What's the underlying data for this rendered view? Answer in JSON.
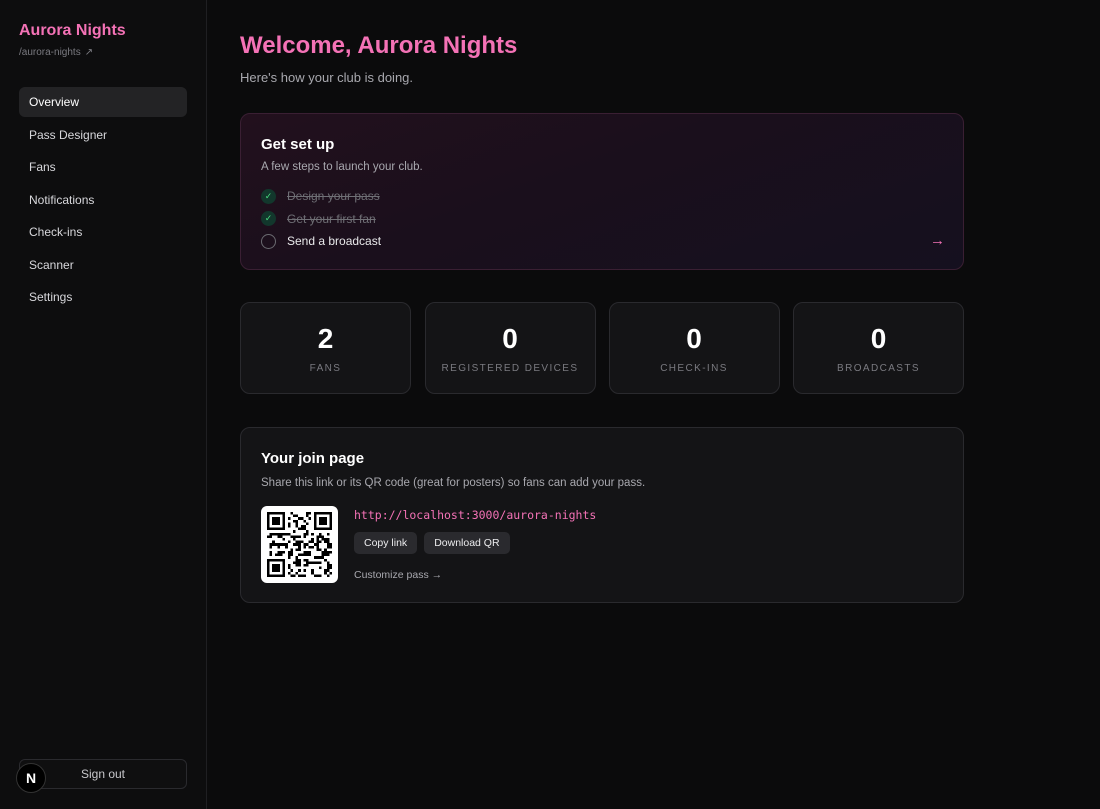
{
  "sidebar": {
    "brand": "Aurora Nights",
    "slug": "/aurora-nights",
    "slug_icon": "external-link-icon",
    "items": [
      {
        "label": "Overview",
        "active": true
      },
      {
        "label": "Pass Designer"
      },
      {
        "label": "Fans"
      },
      {
        "label": "Notifications"
      },
      {
        "label": "Check-ins"
      },
      {
        "label": "Scanner"
      },
      {
        "label": "Settings"
      }
    ],
    "sign_out": "Sign out",
    "logo_letter": "N"
  },
  "header": {
    "title": "Welcome, Aurora Nights",
    "subtitle": "Here's how your club is doing."
  },
  "setup": {
    "title": "Get set up",
    "description": "A few steps to launch your club.",
    "steps": [
      {
        "label": "Design your pass",
        "done": true
      },
      {
        "label": "Get your first fan",
        "done": true
      },
      {
        "label": "Send a broadcast",
        "done": false
      }
    ],
    "arrow": "→"
  },
  "stats": [
    {
      "value": "2",
      "label": "FANS"
    },
    {
      "value": "0",
      "label": "REGISTERED DEVICES"
    },
    {
      "value": "0",
      "label": "CHECK-INS"
    },
    {
      "value": "0",
      "label": "BROADCASTS"
    }
  ],
  "join": {
    "title": "Your join page",
    "description": "Share this link or its QR code (great for posters) so fans can add your pass.",
    "url": "http://localhost:3000/aurora-nights",
    "copy_label": "Copy link",
    "download_label": "Download QR",
    "customize_label": "Customize pass →"
  },
  "colors": {
    "accent": "#f472b6",
    "background": "#0b0b0c",
    "card": "#141416",
    "check": "#4ade80"
  }
}
